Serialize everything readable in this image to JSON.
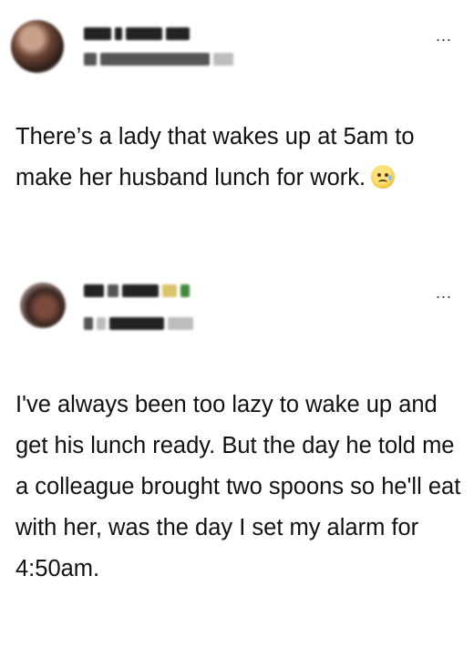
{
  "posts": [
    {
      "author_name": "",
      "author_handle": "",
      "more_label": "...",
      "text": "There’s a lady that wakes up at 5am to make her husband lunch for work.",
      "emoji_icon": "tear-smile-emoji-icon"
    },
    {
      "author_name": "",
      "author_handle": "",
      "more_label": "...",
      "text": "I've always been too lazy to wake up and get his lunch ready. But the day he told me a colleague brought two spoons so he'll eat with her, was the day I set my alarm for 4:50am."
    }
  ]
}
